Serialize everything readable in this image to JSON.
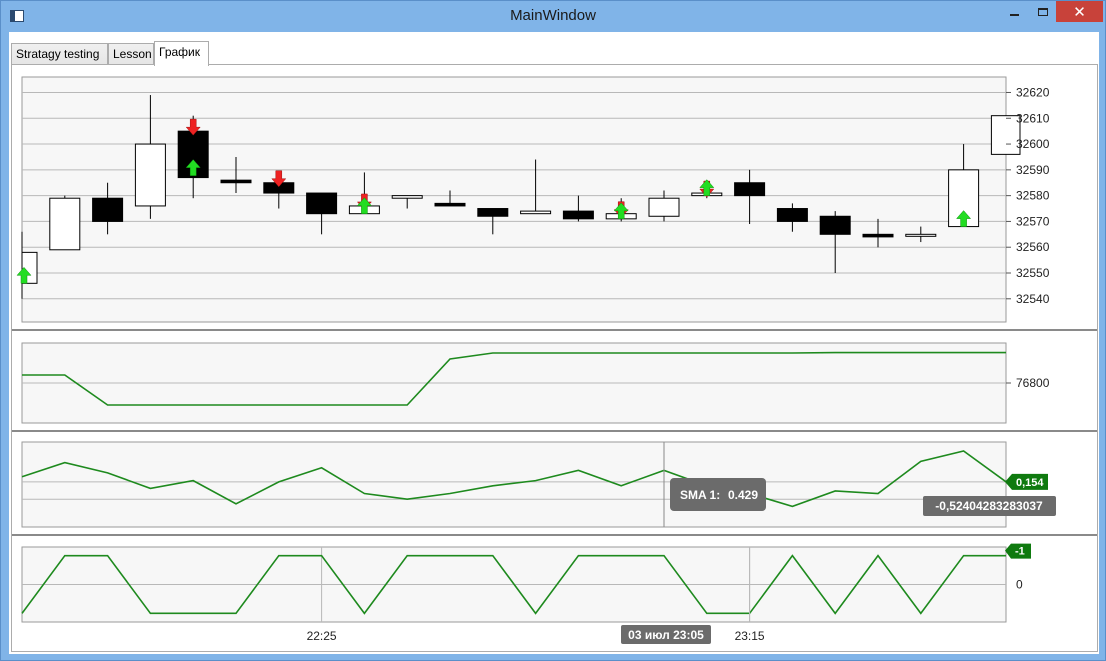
{
  "window": {
    "title": "MainWindow",
    "close_glyph": "✕"
  },
  "tabs": [
    {
      "label": "Stratagy testing",
      "active": false
    },
    {
      "label": "Lesson",
      "active": false
    },
    {
      "label": "График",
      "active": true
    }
  ],
  "colors": {
    "line": "#1e8a1e",
    "bull_fill": "#ffffff",
    "bear_fill": "#000000",
    "sell_arrow": "#ee2222",
    "buy_arrow": "#22dd22",
    "grid": "#b8b8b8",
    "panel_bg": "#f7f7f7",
    "tooltip_bg": "#6b6b6b",
    "badge_bg": "#0f7a0f"
  },
  "chart_data": [
    {
      "type": "candlestick",
      "yticks": [
        32540,
        32550,
        32560,
        32570,
        32580,
        32590,
        32600,
        32610,
        32620
      ],
      "ylim": [
        32531,
        32626
      ],
      "candles": [
        {
          "o": 32546,
          "h": 32566,
          "l": 32540,
          "c": 32558
        },
        {
          "o": 32559,
          "h": 32580,
          "l": 32559,
          "c": 32579
        },
        {
          "o": 32579,
          "h": 32585,
          "l": 32565,
          "c": 32570
        },
        {
          "o": 32576,
          "h": 32619,
          "l": 32571,
          "c": 32600
        },
        {
          "o": 32605,
          "h": 32611,
          "l": 32579,
          "c": 32587
        },
        {
          "o": 32586,
          "h": 32595,
          "l": 32581,
          "c": 32585
        },
        {
          "o": 32585,
          "h": 32587,
          "l": 32575,
          "c": 32581
        },
        {
          "o": 32581,
          "h": 32581,
          "l": 32565,
          "c": 32573
        },
        {
          "o": 32573,
          "h": 32589,
          "l": 32573,
          "c": 32576
        },
        {
          "o": 32579,
          "h": 32580,
          "l": 32575,
          "c": 32580
        },
        {
          "o": 32577,
          "h": 32582,
          "l": 32576,
          "c": 32576
        },
        {
          "o": 32575,
          "h": 32575,
          "l": 32565,
          "c": 32572
        },
        {
          "o": 32573,
          "h": 32594,
          "l": 32573,
          "c": 32574
        },
        {
          "o": 32574,
          "h": 32580,
          "l": 32570,
          "c": 32571
        },
        {
          "o": 32571,
          "h": 32579,
          "l": 32570,
          "c": 32573
        },
        {
          "o": 32572,
          "h": 32582,
          "l": 32570,
          "c": 32579
        },
        {
          "o": 32580,
          "h": 32582,
          "l": 32579,
          "c": 32581
        },
        {
          "o": 32585,
          "h": 32590,
          "l": 32569,
          "c": 32580
        },
        {
          "o": 32575,
          "h": 32577,
          "l": 32566,
          "c": 32570
        },
        {
          "o": 32572,
          "h": 32574,
          "l": 32550,
          "c": 32565
        },
        {
          "o": 32565,
          "h": 32571,
          "l": 32560,
          "c": 32564
        },
        {
          "o": 32565,
          "h": 32568,
          "l": 32562,
          "c": 32565
        },
        {
          "o": 32568,
          "h": 32600,
          "l": 32568,
          "c": 32590
        },
        {
          "o": 32596,
          "h": 32611,
          "l": 32596,
          "c": 32611
        }
      ],
      "signals": [
        {
          "i": 0,
          "dir": "buy"
        },
        {
          "i": 4,
          "dir": "sell"
        },
        {
          "i": 4,
          "dir": "buy"
        },
        {
          "i": 6,
          "dir": "sell"
        },
        {
          "i": 8,
          "dir": "sell"
        },
        {
          "i": 8,
          "dir": "buy"
        },
        {
          "i": 14,
          "dir": "sell"
        },
        {
          "i": 14,
          "dir": "buy"
        },
        {
          "i": 16,
          "dir": "sell"
        },
        {
          "i": 16,
          "dir": "buy"
        },
        {
          "i": 22,
          "dir": "buy"
        }
      ]
    },
    {
      "type": "line",
      "yticks": [
        76800
      ],
      "ylim": [
        76700,
        76900
      ],
      "points": [
        [
          0,
          76820
        ],
        [
          1,
          76820
        ],
        [
          2,
          76745
        ],
        [
          3,
          76745
        ],
        [
          4,
          76745
        ],
        [
          5,
          76745
        ],
        [
          6,
          76745
        ],
        [
          7,
          76745
        ],
        [
          8,
          76745
        ],
        [
          9,
          76745
        ],
        [
          10,
          76860
        ],
        [
          11,
          76875
        ],
        [
          12,
          76875
        ],
        [
          13,
          76875
        ],
        [
          14,
          76875
        ],
        [
          15,
          76875
        ],
        [
          16,
          76875
        ],
        [
          17,
          76875
        ],
        [
          18,
          76875
        ],
        [
          19,
          76876
        ],
        [
          20,
          76876
        ],
        [
          21,
          76876
        ],
        [
          22,
          76876
        ],
        [
          23,
          76876
        ]
      ]
    },
    {
      "type": "line",
      "indicator": "SMA 1",
      "values": [
        0.35,
        0.9,
        0.5,
        -0.1,
        0.2,
        -0.7,
        0.15,
        0.7,
        -0.3,
        -0.52,
        -0.3,
        0.0,
        0.2,
        0.6,
        0.0,
        0.6,
        0.0,
        -0.3,
        -0.8,
        -0.2,
        -0.3,
        0.95,
        1.35,
        0.154
      ],
      "ylim": [
        -1.6,
        1.7
      ],
      "grid_values": [
        0.154,
        -0.524
      ],
      "tooltip": {
        "label": "SMA 1:",
        "value": "0.429",
        "index": 15
      },
      "last_value_badge": "0,154",
      "cursor_value_badge": "-0,52404283283037"
    },
    {
      "type": "line",
      "values": [
        -1,
        1,
        1,
        -1,
        -1,
        -1,
        1,
        1,
        -1,
        1,
        1,
        1,
        -1,
        1,
        1,
        1,
        -1,
        -1,
        1,
        -1,
        1,
        -1,
        1,
        1
      ],
      "ylim": [
        -1.3,
        1.3
      ],
      "yticks": [
        0
      ],
      "last_value_badge": "-1"
    }
  ],
  "time_axis": {
    "ticks": [
      {
        "label": "22:25",
        "i": 7
      },
      {
        "label": "23:15",
        "i": 17
      }
    ],
    "cursor_label": "03 июл 23:05",
    "cursor_index": 15
  }
}
